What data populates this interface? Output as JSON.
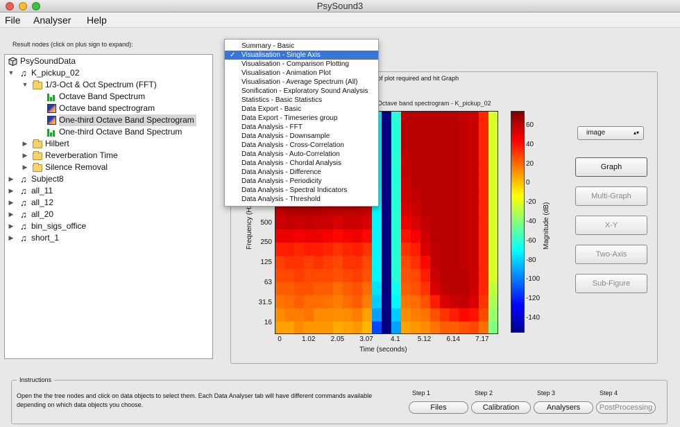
{
  "window": {
    "title": "PsySound3"
  },
  "menubar": [
    "File",
    "Analyser",
    "Help"
  ],
  "tree": {
    "header": "Result nodes (click on plus sign to expand):",
    "root": "PsySoundData",
    "items": [
      {
        "label": "K_pickup_02",
        "level": 1,
        "icon": "music-note-icon",
        "arrow": "expanded"
      },
      {
        "label": "1/3-Oct & Oct Spectrum (FFT)",
        "level": 2,
        "icon": "folder-icon",
        "arrow": "expanded"
      },
      {
        "label": "Octave Band Spectrum",
        "level": 3,
        "icon": "bar-chart-icon",
        "arrow": ""
      },
      {
        "label": "Octave band spectrogram",
        "level": 3,
        "icon": "spectrogram-icon",
        "arrow": ""
      },
      {
        "label": "One-third Octave Band Spectrogram",
        "level": 3,
        "icon": "spectrogram-icon",
        "arrow": "",
        "selected": true
      },
      {
        "label": "One-third Octave Band Spectrum",
        "level": 3,
        "icon": "bar-chart-icon",
        "arrow": ""
      },
      {
        "label": "Hilbert",
        "level": 2,
        "icon": "folder-icon",
        "arrow": "collapsed"
      },
      {
        "label": "Reverberation Time",
        "level": 2,
        "icon": "folder-icon",
        "arrow": "collapsed"
      },
      {
        "label": "Silence Removal",
        "level": 2,
        "icon": "folder-icon",
        "arrow": "collapsed"
      },
      {
        "label": "Subject8",
        "level": 1,
        "icon": "music-note-icon",
        "arrow": "collapsed"
      },
      {
        "label": "all_11",
        "level": 1,
        "icon": "music-note-icon",
        "arrow": "collapsed"
      },
      {
        "label": "all_12",
        "level": 1,
        "icon": "music-note-icon",
        "arrow": "collapsed"
      },
      {
        "label": "all_20",
        "level": 1,
        "icon": "music-note-icon",
        "arrow": "collapsed"
      },
      {
        "label": "bin_sigs_office",
        "level": 1,
        "icon": "music-note-icon",
        "arrow": "collapsed"
      },
      {
        "label": "short_1",
        "level": 1,
        "icon": "music-note-icon",
        "arrow": "collapsed"
      }
    ]
  },
  "panel": {
    "hint_visible": "of plot required and hit Graph",
    "plot_title_visible": "Octave band spectrogram - K_pickup_02",
    "plot_type_select": "image",
    "buttons": [
      {
        "label": "Graph",
        "enabled": true
      },
      {
        "label": "Multi-Graph",
        "enabled": false
      },
      {
        "label": "X-Y",
        "enabled": false
      },
      {
        "label": "Two-Axis",
        "enabled": false
      },
      {
        "label": "Sub-Figure",
        "enabled": false
      }
    ]
  },
  "dropdown": {
    "selected": "Visualisation - Single Axis",
    "items": [
      "Summary - Basic",
      "Visualisation - Single Axis",
      "Visualisation - Comparison Plotting",
      "Visualisation - Animation Plot",
      "Visualisation - Average Spectrum (All)",
      "Sonification - Exploratory Sound Analysis",
      "Statistics - Basic Statistics",
      "Data Export - Basic",
      "Data Export - Timeseries group",
      "Data Analysis - FFT",
      "Data Analysis - Downsample",
      "Data Analysis - Cross-Correlation",
      "Data Analysis - Auto-Correlation",
      "Data Analysis - Chordal Analysis",
      "Data Analysis - Difference",
      "Data Analysis - Periodicity",
      "Data Analysis - Spectral Indicators",
      "Data Analysis - Threshold"
    ]
  },
  "chart_data": {
    "type": "heatmap",
    "title": "Octave band spectrogram - K_pickup_02",
    "xlabel": "Time (seconds)",
    "ylabel": "Frequency (Hz)",
    "x_ticks": [
      "0",
      "1.02",
      "2.05",
      "3.07",
      "4.1",
      "5.12",
      "6.14",
      "7.17"
    ],
    "y_ticks": [
      "16",
      "31.5",
      "63",
      "125",
      "250",
      "500"
    ],
    "colorbar_label": "Magnitude (dB)",
    "colorbar_ticks": [
      "60",
      "40",
      "20",
      "0",
      "-20",
      "-40",
      "-60",
      "-80",
      "-100",
      "-120",
      "-140"
    ],
    "clim": [
      -155,
      75
    ],
    "columns": 23,
    "rows": 17,
    "grid_dB": [
      [
        10,
        10,
        15,
        12,
        12,
        12,
        8,
        10,
        12,
        5,
        -110,
        -155,
        -90,
        10,
        12,
        15,
        20,
        25,
        25,
        28,
        30,
        22,
        -40
      ],
      [
        15,
        18,
        18,
        20,
        15,
        15,
        14,
        15,
        18,
        10,
        -90,
        -155,
        -80,
        15,
        18,
        20,
        28,
        35,
        40,
        45,
        42,
        30,
        -35
      ],
      [
        20,
        22,
        25,
        22,
        22,
        20,
        18,
        22,
        25,
        18,
        -80,
        -155,
        -70,
        20,
        22,
        28,
        40,
        55,
        58,
        60,
        55,
        35,
        -30
      ],
      [
        25,
        25,
        28,
        28,
        25,
        25,
        22,
        25,
        28,
        22,
        -75,
        -155,
        -65,
        25,
        28,
        35,
        55,
        60,
        62,
        62,
        58,
        38,
        -25
      ],
      [
        30,
        30,
        32,
        30,
        30,
        30,
        28,
        30,
        32,
        28,
        -70,
        -155,
        -60,
        28,
        30,
        40,
        58,
        62,
        62,
        62,
        58,
        38,
        -20
      ],
      [
        32,
        35,
        35,
        32,
        35,
        32,
        30,
        35,
        35,
        30,
        -70,
        -155,
        -60,
        30,
        35,
        45,
        60,
        62,
        62,
        60,
        58,
        38,
        -20
      ],
      [
        40,
        40,
        38,
        40,
        40,
        38,
        35,
        38,
        40,
        35,
        -70,
        -155,
        -60,
        35,
        40,
        55,
        60,
        62,
        62,
        60,
        58,
        38,
        -20
      ],
      [
        50,
        50,
        48,
        50,
        50,
        48,
        45,
        48,
        50,
        45,
        -70,
        -155,
        -60,
        42,
        48,
        58,
        62,
        62,
        62,
        60,
        58,
        38,
        -20
      ],
      [
        58,
        60,
        58,
        60,
        58,
        58,
        55,
        58,
        58,
        55,
        -70,
        -155,
        -60,
        50,
        55,
        60,
        62,
        62,
        62,
        60,
        58,
        38,
        -20
      ],
      [
        60,
        62,
        62,
        62,
        62,
        60,
        60,
        60,
        60,
        58,
        -70,
        -155,
        -60,
        55,
        58,
        62,
        62,
        62,
        62,
        60,
        58,
        38,
        -20
      ],
      [
        62,
        62,
        62,
        62,
        62,
        62,
        60,
        62,
        62,
        60,
        -70,
        -155,
        -60,
        58,
        60,
        62,
        62,
        62,
        62,
        60,
        58,
        38,
        -20
      ],
      [
        62,
        62,
        62,
        62,
        62,
        62,
        62,
        62,
        62,
        60,
        -70,
        -155,
        -60,
        58,
        62,
        62,
        62,
        62,
        62,
        60,
        58,
        38,
        -20
      ],
      [
        62,
        62,
        62,
        62,
        62,
        62,
        62,
        62,
        62,
        60,
        -70,
        -155,
        -60,
        60,
        62,
        62,
        62,
        62,
        62,
        60,
        58,
        38,
        -20
      ],
      [
        62,
        62,
        62,
        62,
        62,
        62,
        62,
        62,
        62,
        62,
        -70,
        -155,
        -60,
        60,
        62,
        62,
        62,
        62,
        62,
        60,
        58,
        38,
        -20
      ],
      [
        62,
        62,
        62,
        62,
        62,
        62,
        62,
        62,
        62,
        62,
        -70,
        -155,
        -60,
        62,
        62,
        62,
        62,
        62,
        62,
        60,
        58,
        38,
        -20
      ],
      [
        62,
        62,
        62,
        62,
        62,
        62,
        62,
        62,
        62,
        62,
        -70,
        -155,
        -60,
        62,
        62,
        62,
        62,
        62,
        62,
        60,
        58,
        38,
        -20
      ],
      [
        62,
        62,
        62,
        62,
        62,
        62,
        62,
        62,
        62,
        62,
        -70,
        -155,
        -60,
        62,
        62,
        62,
        62,
        62,
        62,
        60,
        58,
        38,
        -20
      ]
    ]
  },
  "instructions": {
    "legend": "Instructions",
    "text": "Open the the tree nodes and click on data objects to select them. Each Data Analyser tab will have different commands available depending on which data objects you choose."
  },
  "steps": [
    {
      "step": "Step 1",
      "label": "Files",
      "enabled": true
    },
    {
      "step": "Step 2",
      "label": "Calibration",
      "enabled": true
    },
    {
      "step": "Step 3",
      "label": "Analysers",
      "enabled": true
    },
    {
      "step": "Step 4",
      "label": "PostProcessing",
      "enabled": false
    }
  ]
}
